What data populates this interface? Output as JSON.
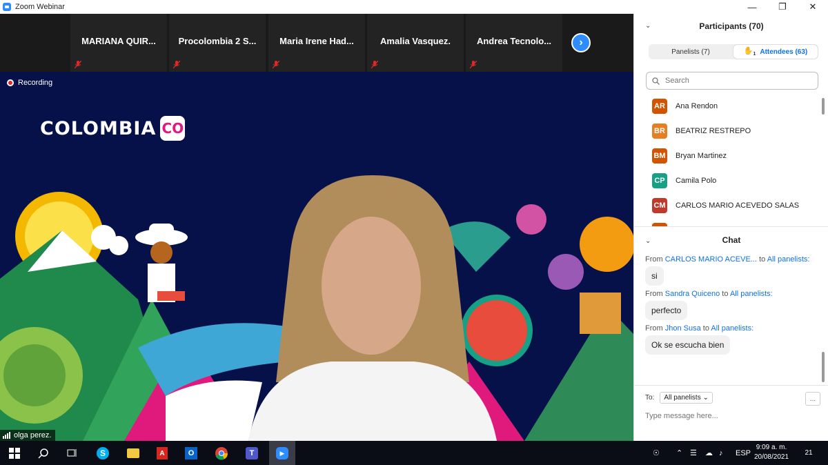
{
  "window": {
    "title": "Zoom Webinar",
    "min_icon": "minimize-icon",
    "restore_icon": "restore-icon",
    "close_icon": "close-icon"
  },
  "strip": {
    "tiles": [
      {
        "name": "MARIANA  QUIR..."
      },
      {
        "name": "Procolombia  2  S..."
      },
      {
        "name": "Maria  Irene  Had..."
      },
      {
        "name": "Amalia Vasquez."
      },
      {
        "name": "Andrea  Tecnolo..."
      }
    ],
    "next_icon": "chevron-right-icon"
  },
  "main": {
    "recording_label": "Recording",
    "logo_text": "COLOMBIA",
    "logo_badge": "CO",
    "speaker": "olga perez."
  },
  "participants": {
    "header": "Participants (70)",
    "tabs": [
      {
        "label": "Panelists (7)"
      },
      {
        "label": "Attendees (63)",
        "badge": "1"
      }
    ],
    "search_placeholder": "Search",
    "list": [
      {
        "initials": "AR",
        "name": "Ana Rendon",
        "color": "#d35400"
      },
      {
        "initials": "BR",
        "name": "BEATRIZ RESTREPO",
        "color": "#e67e22"
      },
      {
        "initials": "BM",
        "name": "Bryan Martinez",
        "color": "#d35400"
      },
      {
        "initials": "CP",
        "name": "Camila Polo",
        "color": "#16a085"
      },
      {
        "initials": "CM",
        "name": "CARLOS MARIO ACEVEDO SALAS",
        "color": "#c0392b"
      }
    ]
  },
  "chat": {
    "header": "Chat",
    "messages": [
      {
        "from_prefix": "From",
        "sender": "CARLOS MARIO ACEVE...",
        "to_word": "to",
        "recipient": "All panelists:",
        "text": "si"
      },
      {
        "from_prefix": "From",
        "sender": "Sandra Quiceno",
        "to_word": "to",
        "recipient": "All panelists:",
        "text": "perfecto"
      },
      {
        "from_prefix": "From",
        "sender": "Jhon Susa",
        "to_word": "to",
        "recipient": "All panelists:",
        "text": "Ok se escucha bien"
      }
    ],
    "to_label": "To:",
    "to_value": "All panelists",
    "more_label": "...",
    "input_placeholder": "Type message here..."
  },
  "taskbar": {
    "lang": "ESP",
    "time": "9:09 a. m.",
    "date": "20/08/2021",
    "notifications": "21"
  }
}
